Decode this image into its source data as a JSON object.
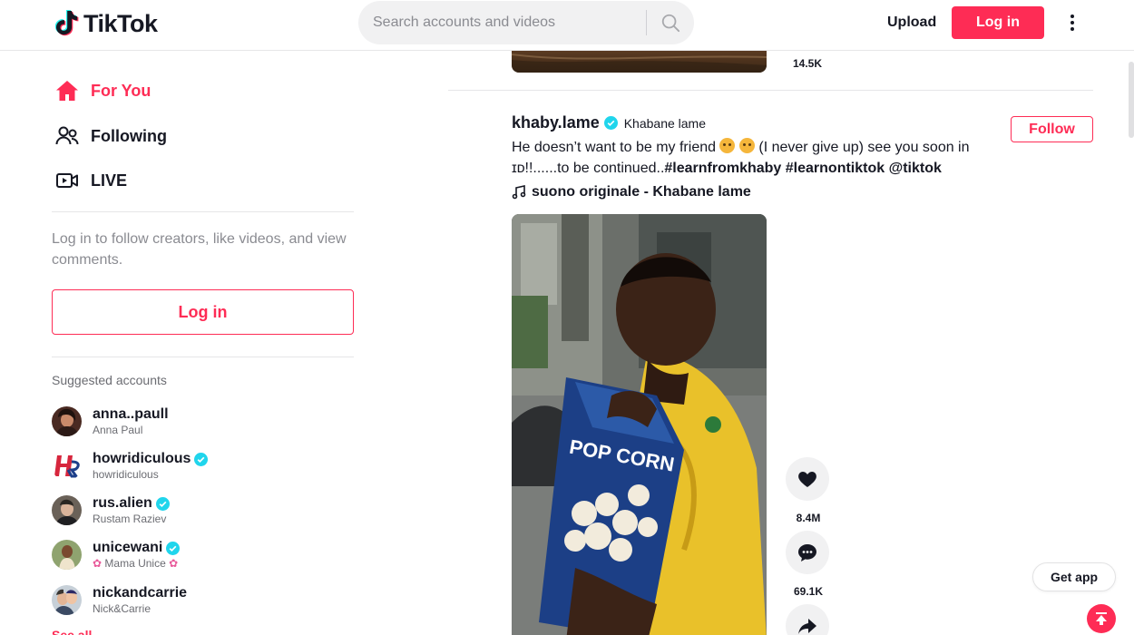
{
  "header": {
    "logo_text": "TikTok",
    "search_placeholder": "Search accounts and videos",
    "upload_label": "Upload",
    "login_label": "Log in"
  },
  "sidebar": {
    "nav": [
      {
        "label": "For You",
        "icon": "home-icon",
        "active": true
      },
      {
        "label": "Following",
        "icon": "people-icon",
        "active": false
      },
      {
        "label": "LIVE",
        "icon": "live-icon",
        "active": false
      }
    ],
    "login_prompt": "Log in to follow creators, like videos, and view comments.",
    "login_label": "Log in",
    "suggested_title": "Suggested accounts",
    "accounts": [
      {
        "username": "anna..paull",
        "name": "Anna Paul",
        "verified": false
      },
      {
        "username": "howridiculous",
        "name": "howridiculous",
        "verified": true
      },
      {
        "username": "rus.alien",
        "name": "Rustam Raziev",
        "verified": true
      },
      {
        "username": "unicewani",
        "name": "Mama Unice",
        "verified": true
      },
      {
        "username": "nickandcarrie",
        "name": "Nick&Carrie",
        "verified": false
      }
    ],
    "see_all": "See all"
  },
  "feed": {
    "previous_count": "14.5K",
    "post": {
      "username": "khaby.lame",
      "nickname": "Khabane lame",
      "follow_label": "Follow",
      "caption_part1": "He doesn’t want to be my friend",
      "caption_part2": "(I never give up) see you soon in",
      "caption_part3": "ɪᴅ!!......to be continued..",
      "hashtag1": "#learnfromkhaby",
      "hashtag2": "#learnontiktok",
      "mention": "@tiktok",
      "music": "suono originale - Khabane lame",
      "video_text": "POP CORN",
      "likes": "8.4M",
      "comments": "69.1K"
    }
  },
  "get_app_label": "Get app",
  "colors": {
    "accent": "#fe2c55",
    "verified": "#20d5ec",
    "text": "#161823"
  }
}
